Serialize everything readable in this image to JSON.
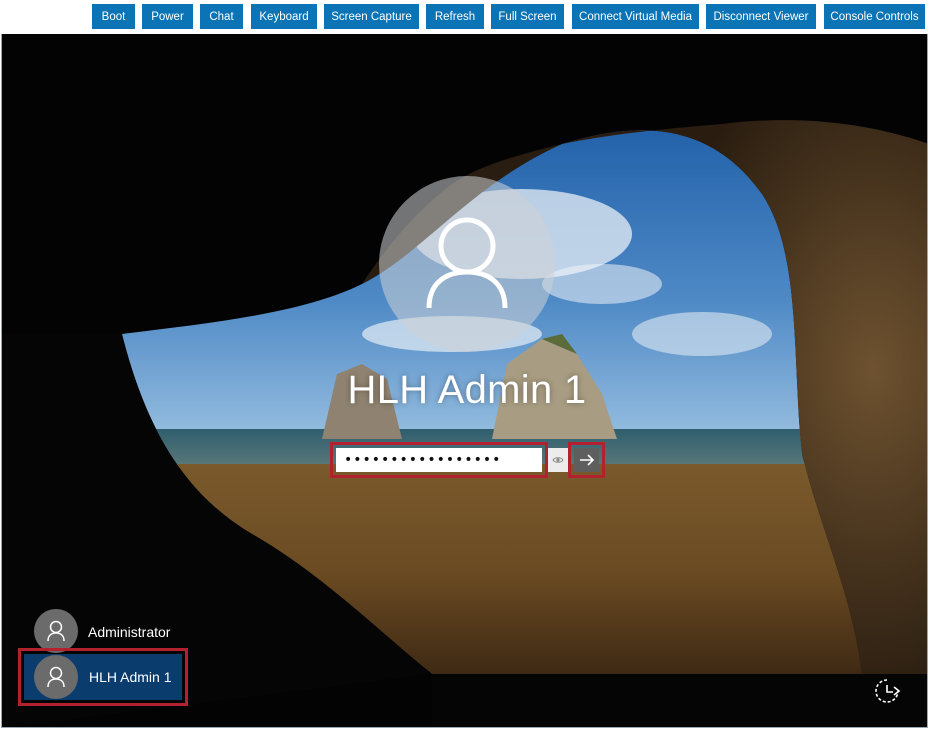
{
  "toolbar": {
    "buttons": [
      {
        "label": "Boot"
      },
      {
        "label": "Power"
      },
      {
        "label": "Chat"
      },
      {
        "label": "Keyboard"
      },
      {
        "label": "Screen Capture"
      },
      {
        "label": "Refresh"
      },
      {
        "label": "Full Screen"
      },
      {
        "label": "Connect Virtual Media"
      },
      {
        "label": "Disconnect Viewer"
      },
      {
        "label": "Console Controls"
      }
    ]
  },
  "login": {
    "user_name": "HLH Admin 1",
    "password_value": "•••••••••••••••••",
    "reveal_icon": "eye-icon",
    "submit_icon": "arrow-right-icon"
  },
  "user_list": [
    {
      "name": "Administrator",
      "icon": "user-icon",
      "selected": false
    },
    {
      "name": "HLH Admin 1",
      "icon": "user-icon",
      "selected": true
    }
  ],
  "footer": {
    "icon": "ease-of-access-icon"
  },
  "colors": {
    "toolbar_button": "#0b74b6",
    "highlight_border": "#b3202e",
    "selected_user_bg": "#0b3c6e"
  }
}
